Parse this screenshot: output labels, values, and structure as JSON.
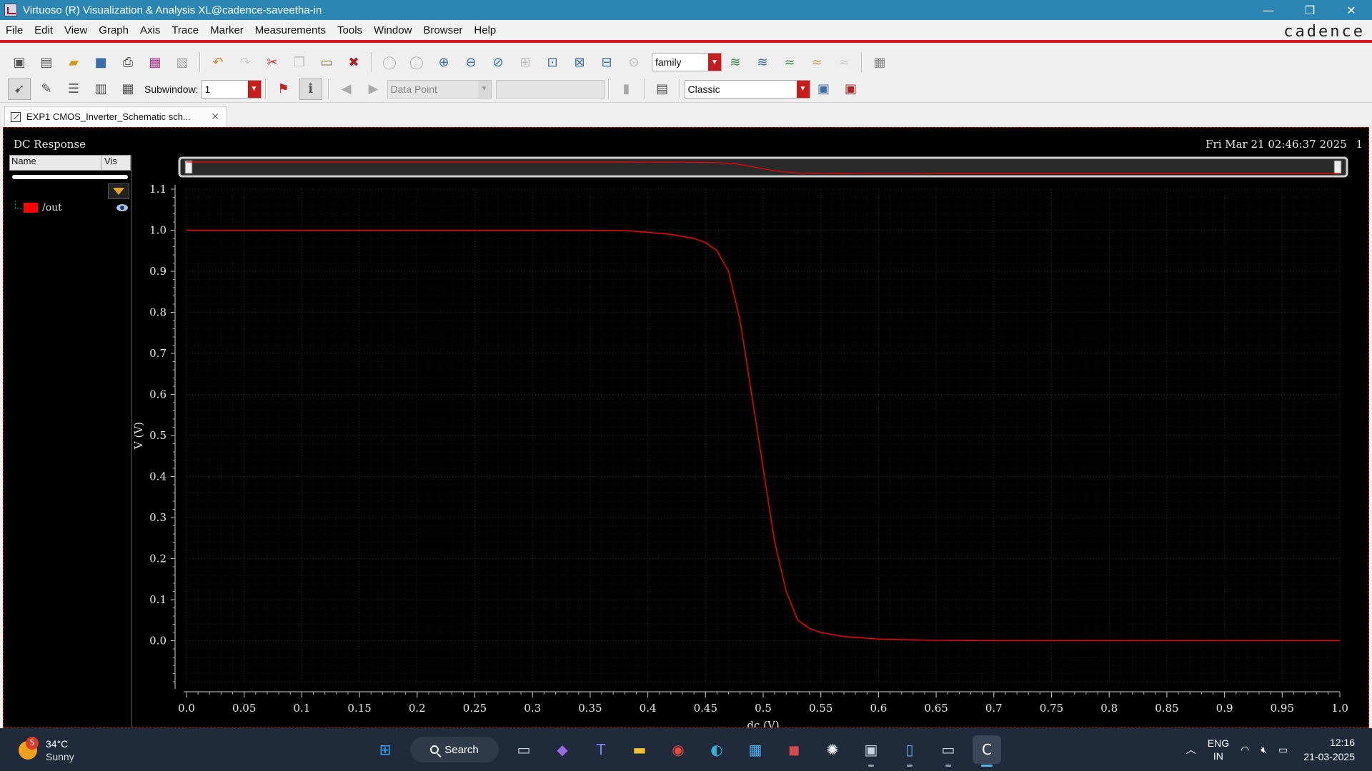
{
  "window": {
    "title": "Virtuoso (R) Visualization & Analysis XL@cadence-saveetha-in",
    "controls": [
      "—",
      "❐",
      "✕"
    ]
  },
  "menubar": {
    "items": [
      "File",
      "Edit",
      "View",
      "Graph",
      "Axis",
      "Trace",
      "Marker",
      "Measurements",
      "Tools",
      "Window",
      "Browser",
      "Help"
    ],
    "brand": "cadence"
  },
  "toolbar1": {
    "family_select": "family"
  },
  "toolbar2": {
    "subwindow_label": "Subwindow:",
    "subwindow_value": "1",
    "marker_type": "Data Point",
    "style_select": "Classic"
  },
  "tabs": [
    {
      "label": "EXP1 CMOS_Inverter_Schematic sch...",
      "close": "✕"
    }
  ],
  "graph": {
    "title": "DC Response",
    "datetime": "Fri Mar 21 02:46:37 2025",
    "subwindow_index": "1",
    "trace_browser": {
      "col_name": "Name",
      "col_vis": "Vis",
      "traces": [
        {
          "name": "/out",
          "color": "#ff0000",
          "visible": true
        }
      ]
    }
  },
  "chart_data": {
    "type": "line",
    "xlabel": "dc (V)",
    "ylabel": "V (V)",
    "xlim": [
      0.0,
      1.0
    ],
    "ylim": [
      -0.1,
      1.1
    ],
    "x_ticks": [
      "0.0",
      "0.05",
      "0.1",
      "0.15",
      "0.2",
      "0.25",
      "0.3",
      "0.35",
      "0.4",
      "0.45",
      "0.5",
      "0.55",
      "0.6",
      "0.65",
      "0.7",
      "0.75",
      "0.8",
      "0.85",
      "0.9",
      "0.95",
      "1.0"
    ],
    "y_ticks": [
      "0.0",
      "0.1",
      "0.2",
      "0.3",
      "0.4",
      "0.5",
      "0.6",
      "0.7",
      "0.8",
      "0.9",
      "1.0",
      "1.1"
    ],
    "grid": true,
    "background": "#000000",
    "series": [
      {
        "name": "/out",
        "color": "#ff0000",
        "x": [
          0.0,
          0.05,
          0.1,
          0.15,
          0.2,
          0.25,
          0.3,
          0.35,
          0.38,
          0.4,
          0.42,
          0.44,
          0.45,
          0.46,
          0.47,
          0.48,
          0.49,
          0.5,
          0.51,
          0.52,
          0.53,
          0.54,
          0.55,
          0.57,
          0.6,
          0.65,
          0.7,
          0.75,
          0.8,
          0.85,
          0.9,
          0.95,
          1.0
        ],
        "y": [
          1.0,
          1.0,
          1.0,
          1.0,
          1.0,
          1.0,
          1.0,
          1.0,
          0.999,
          0.995,
          0.99,
          0.98,
          0.97,
          0.95,
          0.9,
          0.78,
          0.6,
          0.42,
          0.24,
          0.12,
          0.05,
          0.03,
          0.02,
          0.01,
          0.004,
          0.001,
          0.0,
          0.0,
          0.0,
          0.0,
          0.0,
          0.0,
          0.0
        ]
      }
    ]
  },
  "taskbar": {
    "weather_temp": "34°C",
    "weather_cond": "Sunny",
    "weather_badge": "5",
    "search_label": "Search",
    "lang_line1": "ENG",
    "lang_line2": "IN",
    "time": "12:16",
    "date": "21-03-2025"
  }
}
